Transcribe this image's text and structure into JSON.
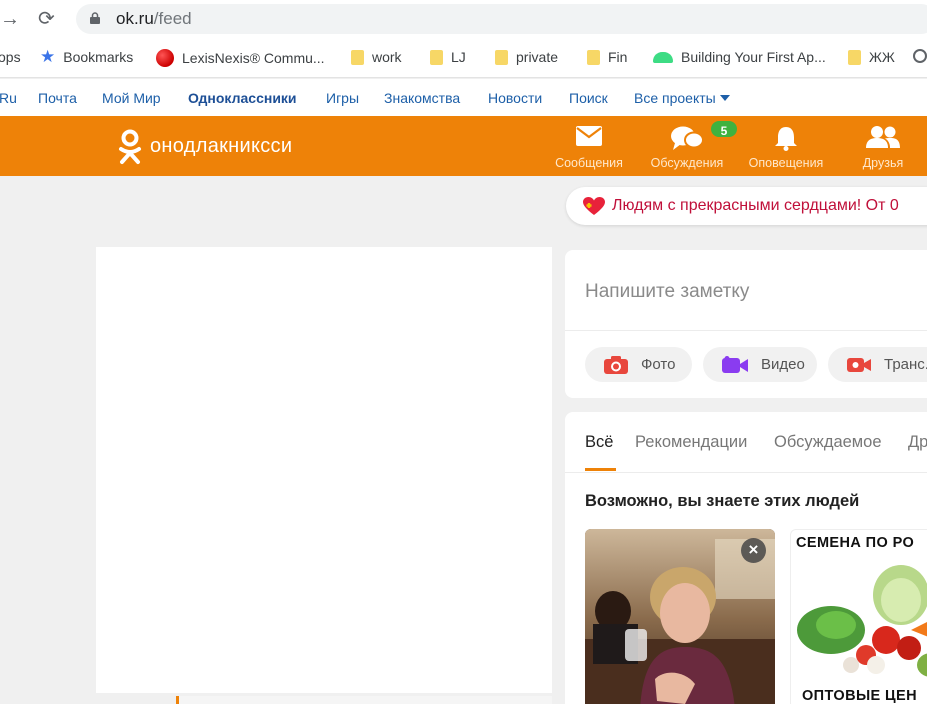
{
  "browser": {
    "url_host": "ok.ru",
    "url_path": "/feed",
    "bookmarks": [
      {
        "label": "ops",
        "icon": "apps-icon"
      },
      {
        "label": "Bookmarks",
        "icon": "star-icon"
      },
      {
        "label": "LexisNexis® Commu...",
        "icon": "lexisnexis-icon"
      },
      {
        "label": "work",
        "icon": "folder-icon"
      },
      {
        "label": "LJ",
        "icon": "folder-icon"
      },
      {
        "label": "private",
        "icon": "folder-icon"
      },
      {
        "label": "Fin",
        "icon": "folder-icon"
      },
      {
        "label": "Building Your First Ap...",
        "icon": "android-icon"
      },
      {
        "label": "ЖЖ",
        "icon": "folder-icon"
      }
    ]
  },
  "portal": {
    "links": [
      "Ru",
      "Почта",
      "Мой Мир",
      "Одноклассники",
      "Игры",
      "Знакомства",
      "Новости",
      "Поиск",
      "Все проекты"
    ]
  },
  "header": {
    "logo_text": "онодлакниксси",
    "accent_color": "#ee8208",
    "nav": [
      {
        "label": "Сообщения",
        "icon": "envelope-icon"
      },
      {
        "label": "Обсуждения",
        "icon": "chat-bubbles-icon"
      },
      {
        "label": "Оповещения",
        "icon": "bell-icon"
      },
      {
        "label": "Друзья",
        "icon": "friends-icon"
      }
    ],
    "discussions_badge": "5"
  },
  "banner": {
    "text": "Людям с прекрасными сердцами! От 0"
  },
  "note": {
    "placeholder": "Напишите заметку",
    "actions": [
      {
        "label": "Фото",
        "icon": "camera-icon"
      },
      {
        "label": "Видео",
        "icon": "video-icon"
      },
      {
        "label": "Транс...",
        "icon": "stream-icon"
      }
    ]
  },
  "feed": {
    "tabs": [
      "Всё",
      "Рекомендации",
      "Обсуждаемое",
      "Др"
    ],
    "active_tab": "Всё",
    "suggestions_title": "Возможно, вы знаете этих людей",
    "ad": {
      "top_text": "СЕМЕНА ПО РО",
      "bottom_text": "ОПТОВЫЕ ЦЕН"
    }
  }
}
